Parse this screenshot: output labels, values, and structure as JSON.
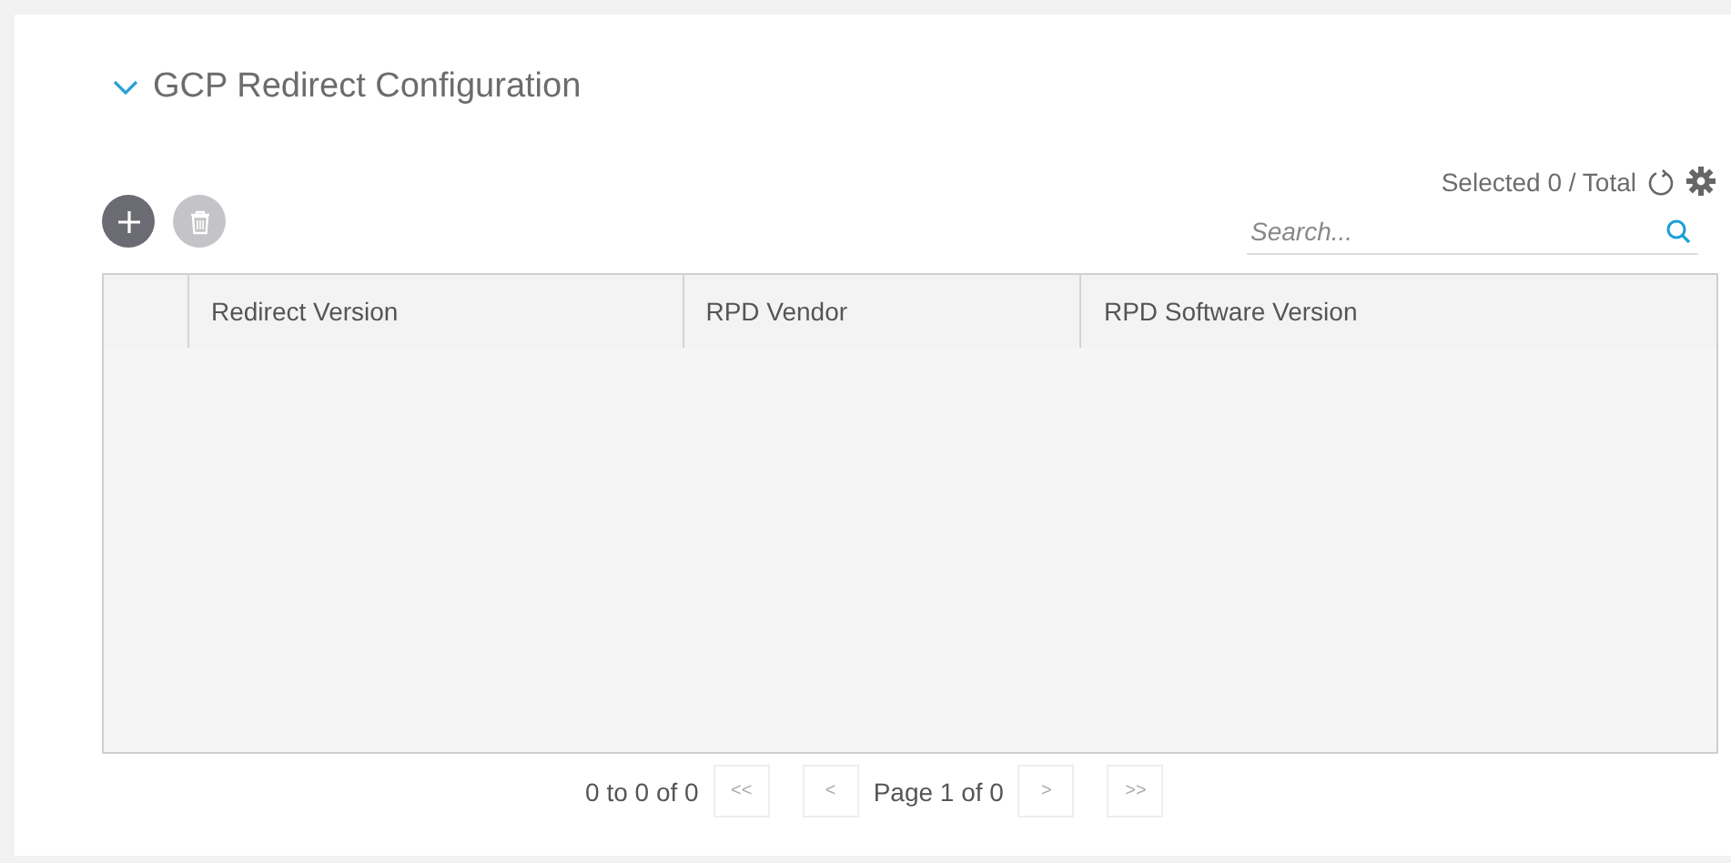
{
  "section": {
    "title": "GCP Redirect Configuration",
    "expanded": true
  },
  "toolbar": {
    "buttons": [
      {
        "kind": "add",
        "disabled": false
      },
      {
        "kind": "delete",
        "disabled": true
      }
    ],
    "selection": "Selected 0 / Total"
  },
  "search": {
    "placeholder": "Search..."
  },
  "table": {
    "columns": [
      "Redirect Version",
      "RPD Vendor",
      "RPD Software Version"
    ]
  },
  "pagination": {
    "range": "0 to 0 of 0",
    "first": "<<",
    "prev": "<",
    "page": "Page 1 of 0",
    "next": ">",
    "last": ">>"
  }
}
